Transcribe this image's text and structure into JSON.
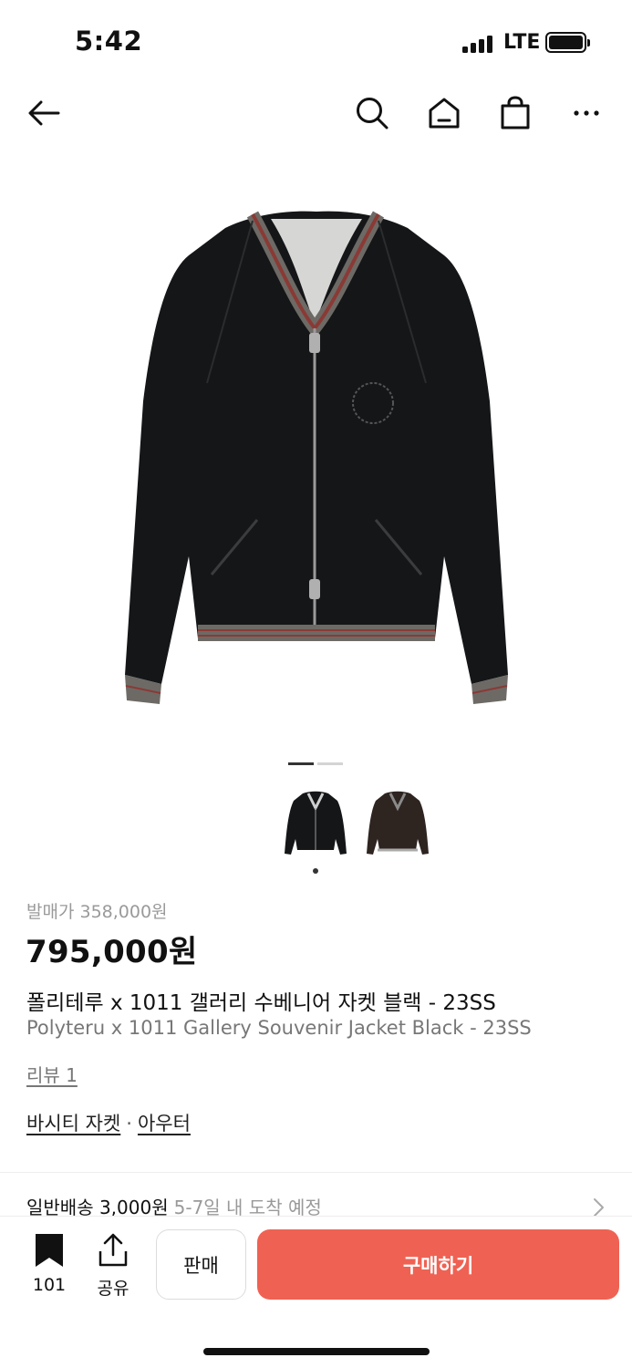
{
  "status_bar": {
    "time": "5:42",
    "network": "LTE"
  },
  "nav": {
    "icons": [
      "back-arrow-icon",
      "search-icon",
      "home-icon",
      "shopping-bag-icon",
      "more-icon"
    ]
  },
  "product": {
    "image_alt_icon": "jacket-image",
    "release_price": "발매가 358,000원",
    "price": "795,000원",
    "title_ko": "폴리테루 x 1011 갤러리 수베니어 자켓 블랙 - 23SS",
    "title_en": "Polyteru x 1011 Gallery Souvenir Jacket Black - 23SS",
    "review_link": "리뷰 1",
    "category_1": "바시티 자켓",
    "category_sep": "·",
    "category_2": "아우터"
  },
  "gallery": {
    "current_page": 1,
    "total_pages": 2,
    "thumbnail_count": 2,
    "selected_thumbnail": 1
  },
  "shipping": {
    "label": "일반배송 3,000원",
    "eta": "5-7일 내 도착 예정"
  },
  "bottom_bar": {
    "bookmark_count": "101",
    "share_label": "공유",
    "sell_label": "판매",
    "buy_label": "구매하기"
  },
  "colors": {
    "buy_button": "#ef6253",
    "release_price": "#9a9a9a",
    "subtitle": "#777777"
  }
}
